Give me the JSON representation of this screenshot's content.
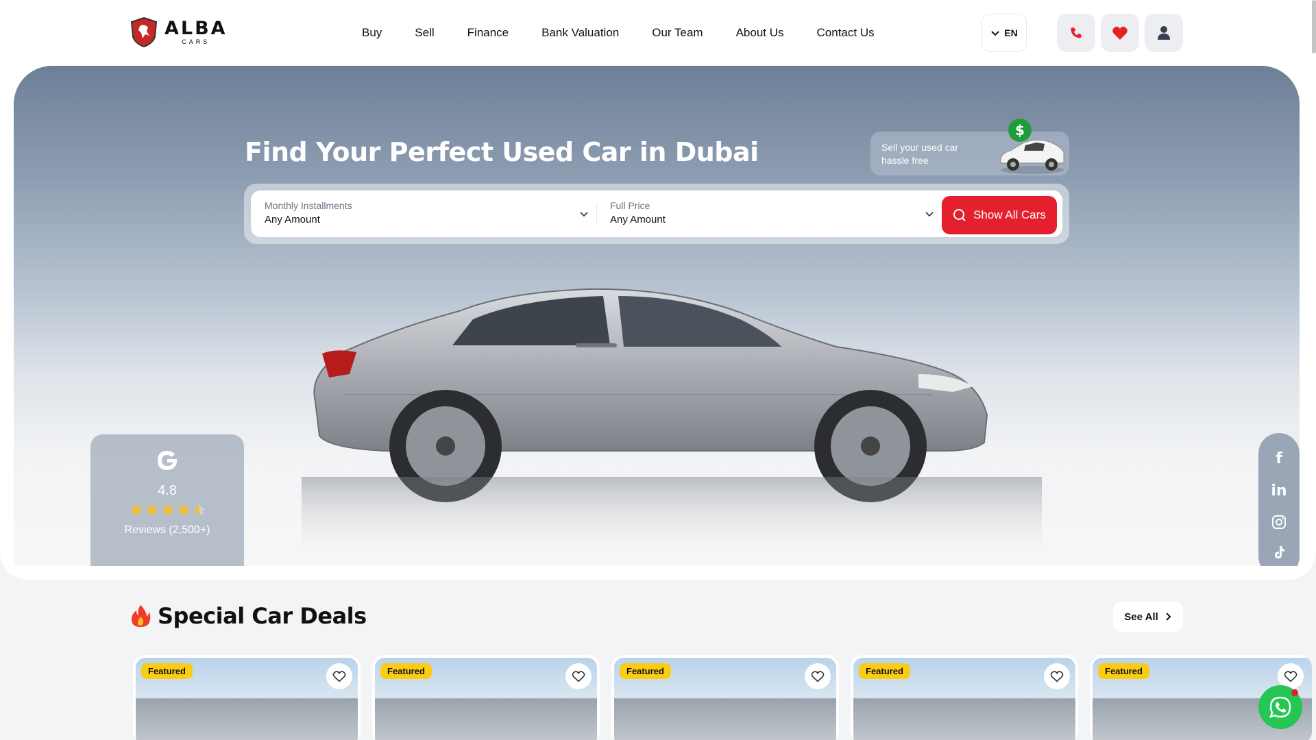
{
  "brand": {
    "name": "ALBA",
    "sub": "CARS"
  },
  "nav": [
    {
      "label": "Buy"
    },
    {
      "label": "Sell"
    },
    {
      "label": "Finance"
    },
    {
      "label": "Bank Valuation"
    },
    {
      "label": "Our Team"
    },
    {
      "label": "About Us"
    },
    {
      "label": "Contact Us"
    }
  ],
  "language": "EN",
  "header_buttons": [
    {
      "icon": "phone-icon"
    },
    {
      "icon": "heart-icon"
    },
    {
      "icon": "user-icon"
    }
  ],
  "hero": {
    "title": "Find Your Perfect Used Car in Dubai",
    "sell_promo": "Sell your used car hassle free"
  },
  "search": {
    "monthly": {
      "label": "Monthly Installments",
      "value": "Any Amount"
    },
    "full_price": {
      "label": "Full Price",
      "value": "Any Amount"
    },
    "button_label": "Show All Cars"
  },
  "reviews": {
    "provider_icon": "google-icon",
    "rating": "4.8",
    "stars": 4.5,
    "count_label": "Reviews (2,500+)"
  },
  "social": [
    "facebook-icon",
    "linkedin-icon",
    "instagram-icon",
    "tiktok-icon"
  ],
  "deals": {
    "title": "Special Car Deals",
    "see_all": "See All",
    "cards": [
      {
        "badge": "Featured"
      },
      {
        "badge": "Featured"
      },
      {
        "badge": "Featured"
      },
      {
        "badge": "Featured"
      },
      {
        "badge": "Featured"
      }
    ]
  },
  "colors": {
    "accent": "#e4202e",
    "badge": "#facc15",
    "whatsapp": "#25c653"
  }
}
